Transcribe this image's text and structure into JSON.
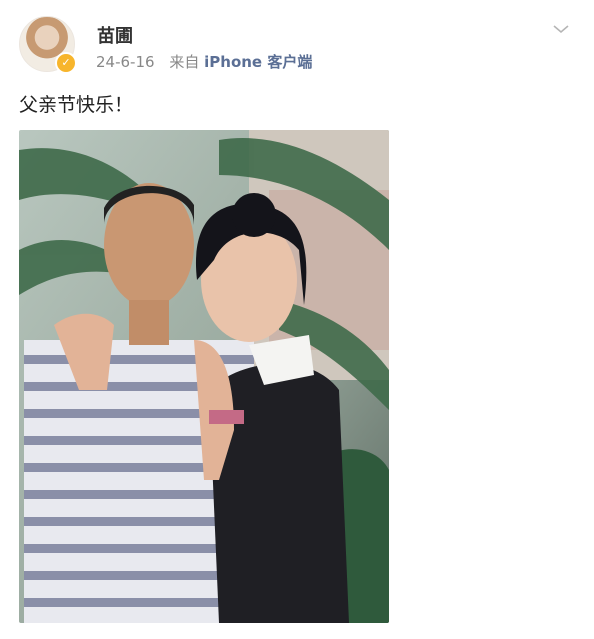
{
  "post": {
    "username": "苗圃",
    "date": "24-6-16",
    "source_prefix": "来自",
    "source_app": "iPhone 客户端",
    "text": "父亲节快乐！"
  },
  "icons": {
    "avatar": "avatar-photo",
    "verified": "verified-badge-icon",
    "menu": "chevron-down-icon"
  },
  "colors": {
    "verified_badge": "#f7b52c",
    "source_link": "#5b6f95",
    "meta_text": "#888888"
  }
}
